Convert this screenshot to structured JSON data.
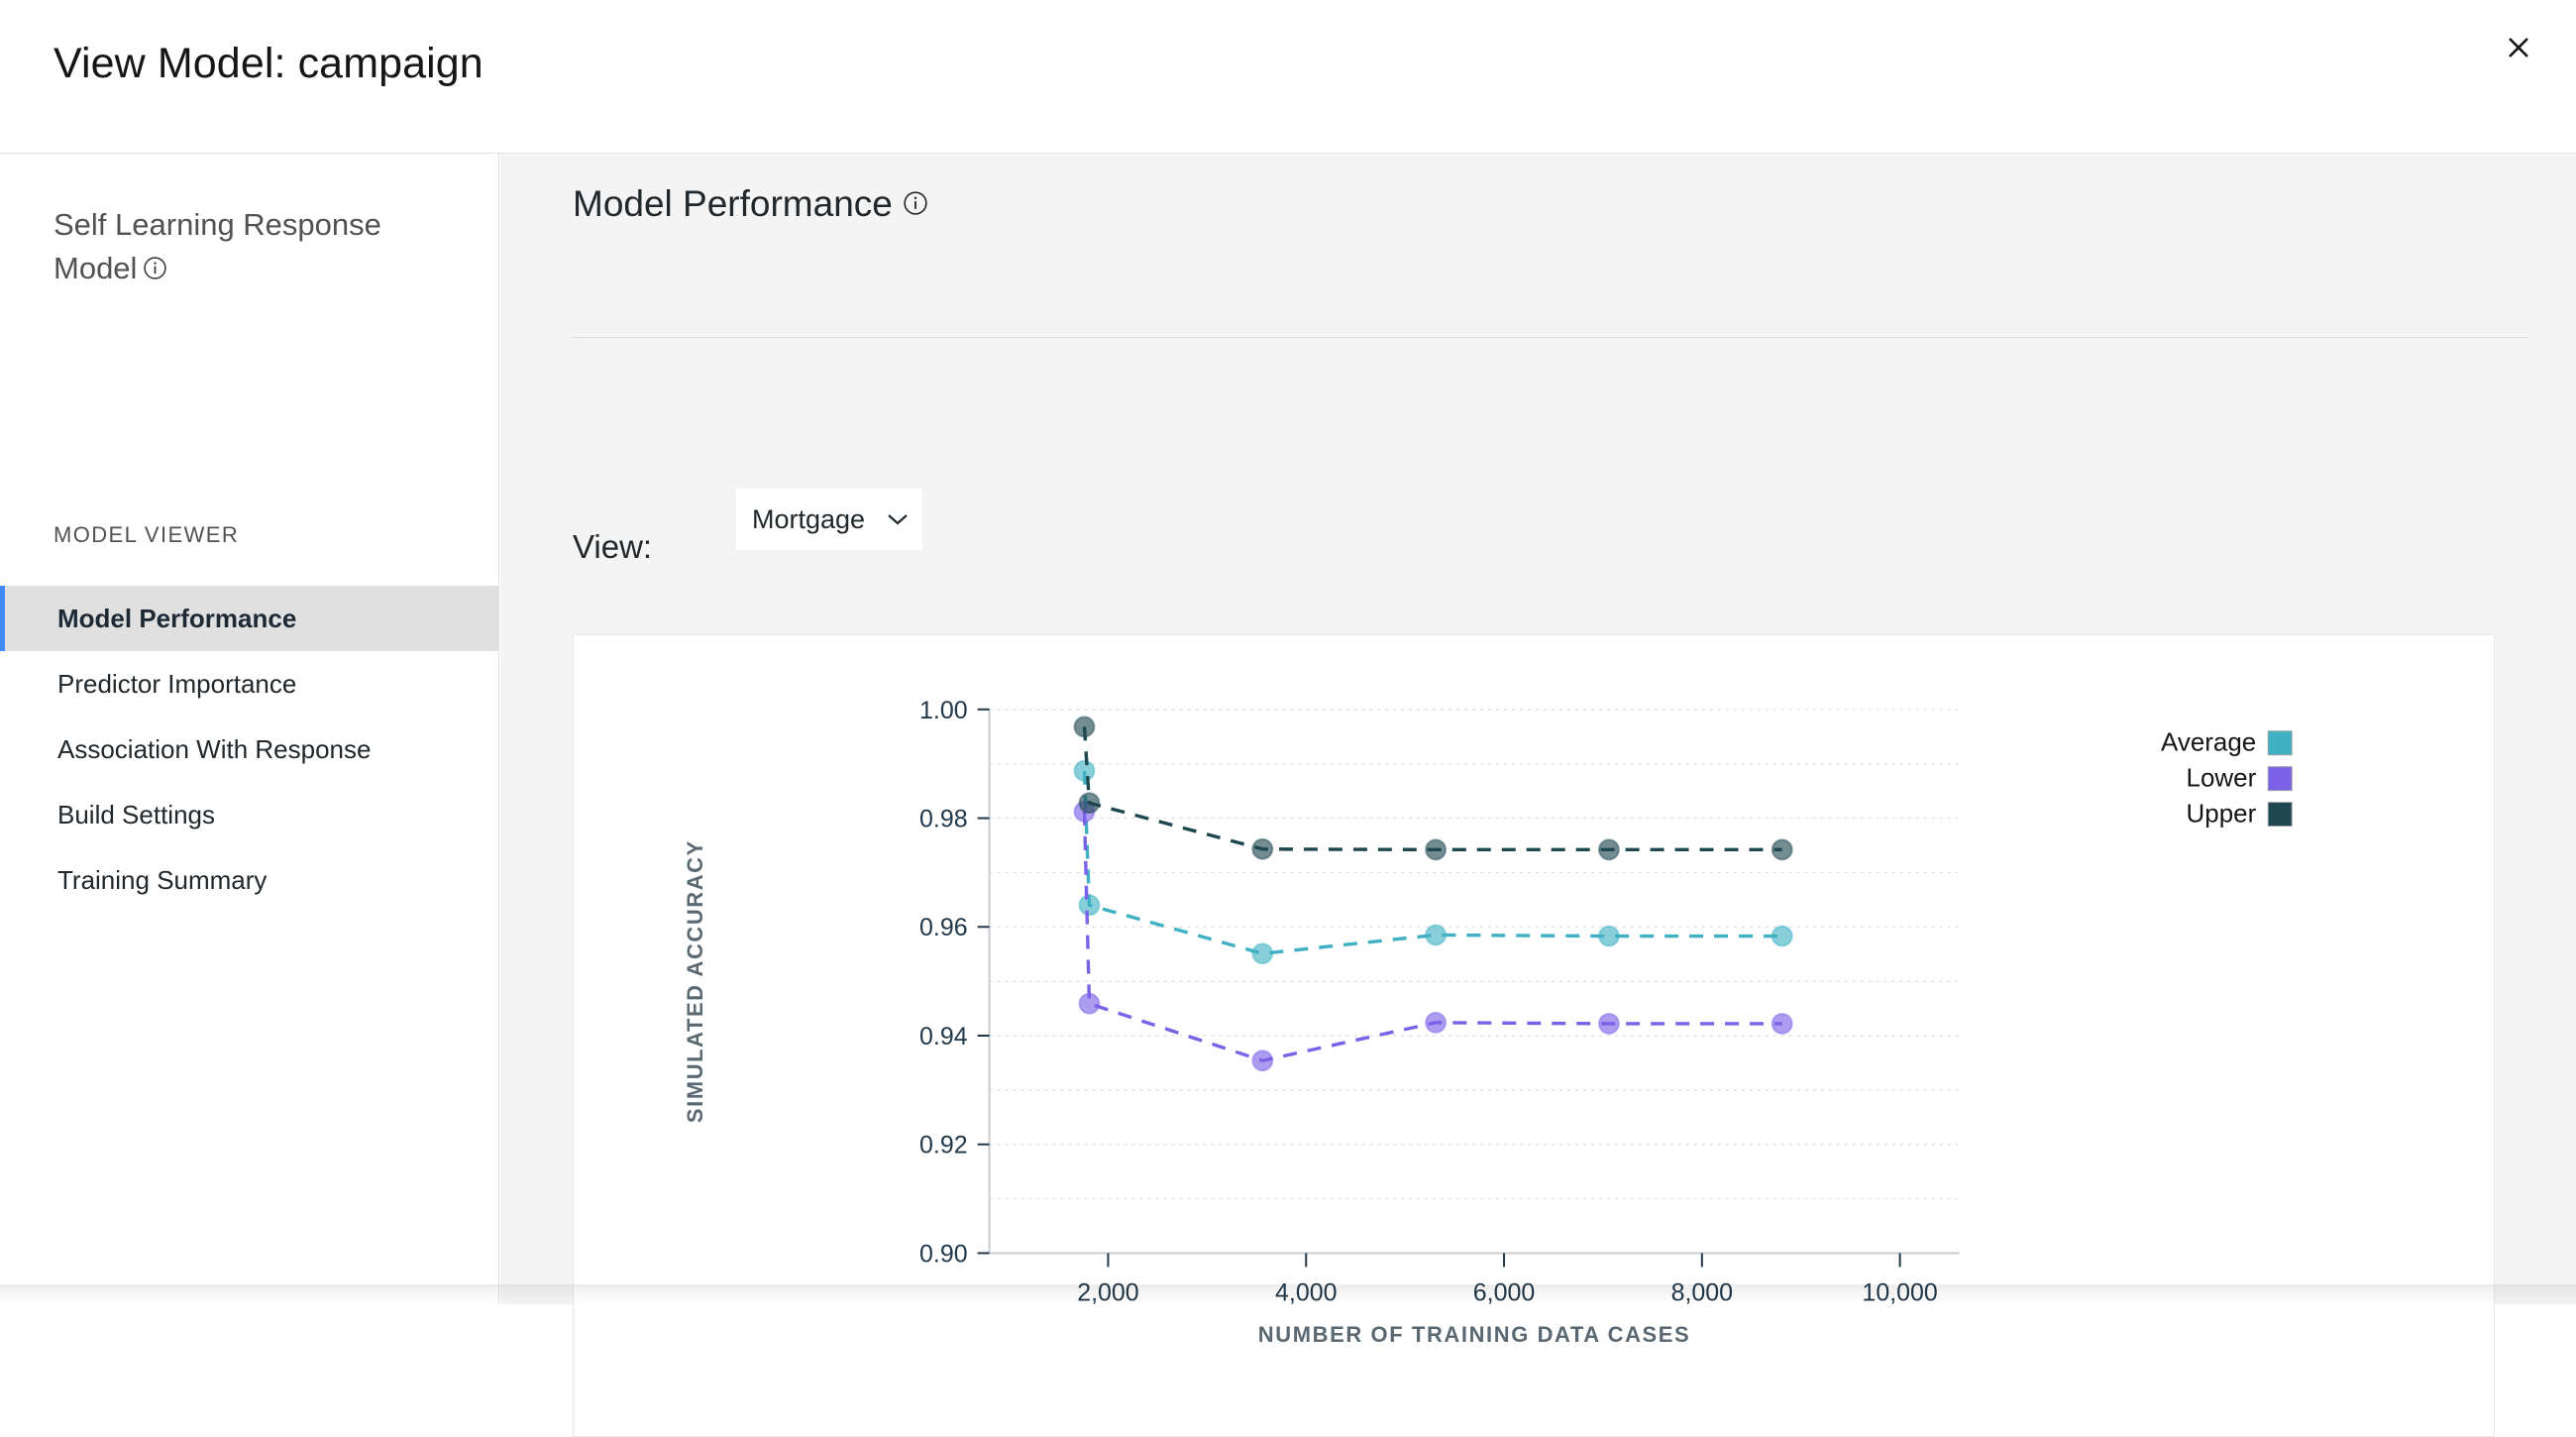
{
  "window": {
    "title": "View Model: campaign",
    "close_label": "×"
  },
  "sidebar": {
    "heading": "Self Learning Response Model",
    "section_label": "MODEL VIEWER",
    "items": [
      {
        "label": "Model Performance",
        "active": true
      },
      {
        "label": "Predictor Importance",
        "active": false
      },
      {
        "label": "Association With Response",
        "active": false
      },
      {
        "label": "Build Settings",
        "active": false
      },
      {
        "label": "Training Summary",
        "active": false
      }
    ]
  },
  "main": {
    "title": "Model Performance",
    "view_label": "View:",
    "view_selected": "Mortgage",
    "view_options": [
      "Mortgage"
    ]
  },
  "colors": {
    "average": "#3fb1c3",
    "lower": "#7b61e8",
    "upper": "#1f4750",
    "accent": "#4589ff",
    "panel_bg": "#f4f4f4",
    "active_nav": "#e0e0e0"
  },
  "chart_data": {
    "type": "line",
    "title": "",
    "xlabel": "NUMBER OF TRAINING DATA CASES",
    "ylabel": "SIMULATED ACCURACY",
    "xlim": [
      800,
      10600
    ],
    "ylim": [
      0.9,
      1.0
    ],
    "xticks": [
      2000,
      4000,
      6000,
      8000,
      10000
    ],
    "xtick_labels": [
      "2,000",
      "4,000",
      "6,000",
      "8,000",
      "10,000"
    ],
    "yticks": [
      0.9,
      0.92,
      0.94,
      0.96,
      0.98,
      1.0
    ],
    "ytick_labels": [
      "0.90",
      "0.92",
      "0.94",
      "0.96",
      "0.98",
      "1.00"
    ],
    "minor_yticks": [
      0.91,
      0.93,
      0.95,
      0.97,
      0.99
    ],
    "grid": true,
    "linestyle": "dashed",
    "marker": "circle",
    "legend_position": "right",
    "series": [
      {
        "name": "Average",
        "color": "#3fb1c3",
        "x": [
          1760,
          1810,
          3560,
          5310,
          7060,
          8810
        ],
        "values": [
          0.9887,
          0.964,
          0.9551,
          0.9585,
          0.9583,
          0.9583
        ]
      },
      {
        "name": "Lower",
        "color": "#7b61e8",
        "x": [
          1760,
          1810,
          3560,
          5310,
          7060,
          8810
        ],
        "values": [
          0.9812,
          0.9459,
          0.9354,
          0.9424,
          0.9422,
          0.9422
        ]
      },
      {
        "name": "Upper",
        "color": "#1f4750",
        "x": [
          1760,
          1810,
          3560,
          5310,
          7060,
          8810
        ],
        "values": [
          0.9968,
          0.9828,
          0.9743,
          0.9742,
          0.9742,
          0.9742
        ]
      }
    ]
  }
}
